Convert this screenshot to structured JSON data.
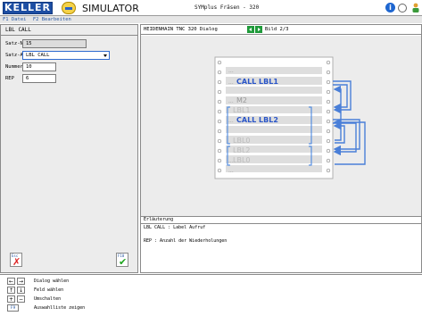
{
  "header": {
    "logo_text": "KELLER",
    "app_title": "SIMULATOR",
    "app_subtitle": "SYMplus Fräsen - 320",
    "info_icon": "i"
  },
  "menu": {
    "items": [
      "F1 Datei",
      "F2 Bearbeiten"
    ]
  },
  "form": {
    "title": "LBL CALL",
    "fields": [
      {
        "label": "Satz-Nr.",
        "value": "15"
      },
      {
        "label": "Satz-Art",
        "value": "LBL CALL"
      },
      {
        "label": "Nummer",
        "value": "10"
      },
      {
        "label": "REP",
        "value": "6"
      }
    ],
    "esc_key": "Esc",
    "f10_key": "F10"
  },
  "dialog": {
    "title": "HEIDENHAIN TNC 320 Dialog",
    "page": "Bild 2/3",
    "labels": {
      "dots1": "...",
      "call1": "CALL LBL1",
      "dots2": "...",
      "m2": "M2",
      "lbl1": "LBL1",
      "dots3": "...",
      "call2": "CALL LBL2",
      "dots4": "...",
      "lbl0a": "LBL0",
      "lbl2": "LBL2",
      "dots5": "...",
      "lbl0b": "LBL0",
      "dots6": "..."
    }
  },
  "explanation": {
    "title": "Erläuterung",
    "line1": "LBL CALL : Label Aufruf",
    "line2": "REP : Anzahl der Wiederholungen"
  },
  "help": {
    "rows": [
      {
        "keys": [
          "←",
          "→"
        ],
        "text": "Dialog wählen"
      },
      {
        "keys": [
          "↑",
          "↓"
        ],
        "text": "Feld wählen"
      },
      {
        "keys": [
          "+",
          "−"
        ],
        "text": "Umschalten"
      },
      {
        "keys": [
          "F9"
        ],
        "text": "Auswahlliste zeigen"
      }
    ]
  },
  "colors": {
    "logo_blue": "#1d4ea3",
    "label_blue": "#2a55c8",
    "arrow_blue": "#4a7fd8",
    "ok_green": "#1ea51e",
    "cancel_red": "#d22222"
  }
}
